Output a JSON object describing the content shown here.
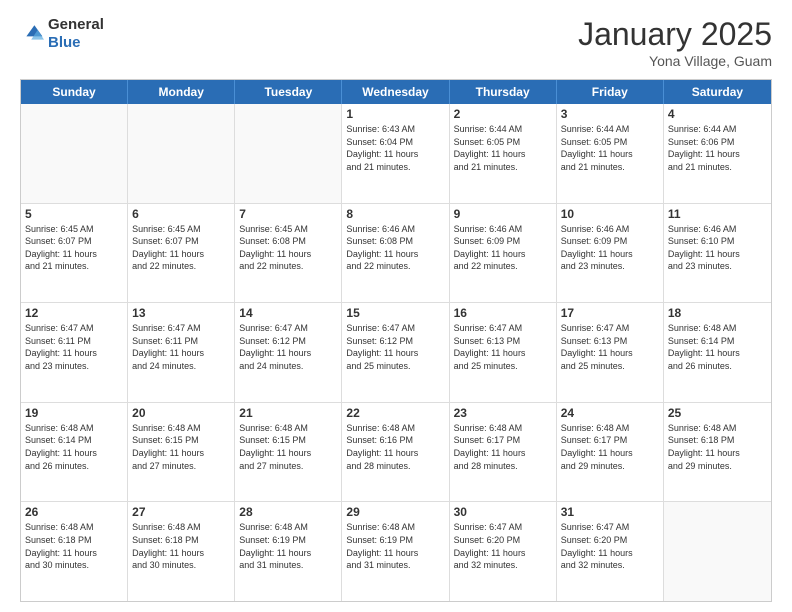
{
  "header": {
    "logo_general": "General",
    "logo_blue": "Blue",
    "month_title": "January 2025",
    "subtitle": "Yona Village, Guam"
  },
  "weekdays": [
    "Sunday",
    "Monday",
    "Tuesday",
    "Wednesday",
    "Thursday",
    "Friday",
    "Saturday"
  ],
  "rows": [
    [
      {
        "day": "",
        "lines": [],
        "empty": true
      },
      {
        "day": "",
        "lines": [],
        "empty": true
      },
      {
        "day": "",
        "lines": [],
        "empty": true
      },
      {
        "day": "1",
        "lines": [
          "Sunrise: 6:43 AM",
          "Sunset: 6:04 PM",
          "Daylight: 11 hours",
          "and 21 minutes."
        ],
        "empty": false
      },
      {
        "day": "2",
        "lines": [
          "Sunrise: 6:44 AM",
          "Sunset: 6:05 PM",
          "Daylight: 11 hours",
          "and 21 minutes."
        ],
        "empty": false
      },
      {
        "day": "3",
        "lines": [
          "Sunrise: 6:44 AM",
          "Sunset: 6:05 PM",
          "Daylight: 11 hours",
          "and 21 minutes."
        ],
        "empty": false
      },
      {
        "day": "4",
        "lines": [
          "Sunrise: 6:44 AM",
          "Sunset: 6:06 PM",
          "Daylight: 11 hours",
          "and 21 minutes."
        ],
        "empty": false
      }
    ],
    [
      {
        "day": "5",
        "lines": [
          "Sunrise: 6:45 AM",
          "Sunset: 6:07 PM",
          "Daylight: 11 hours",
          "and 21 minutes."
        ],
        "empty": false
      },
      {
        "day": "6",
        "lines": [
          "Sunrise: 6:45 AM",
          "Sunset: 6:07 PM",
          "Daylight: 11 hours",
          "and 22 minutes."
        ],
        "empty": false
      },
      {
        "day": "7",
        "lines": [
          "Sunrise: 6:45 AM",
          "Sunset: 6:08 PM",
          "Daylight: 11 hours",
          "and 22 minutes."
        ],
        "empty": false
      },
      {
        "day": "8",
        "lines": [
          "Sunrise: 6:46 AM",
          "Sunset: 6:08 PM",
          "Daylight: 11 hours",
          "and 22 minutes."
        ],
        "empty": false
      },
      {
        "day": "9",
        "lines": [
          "Sunrise: 6:46 AM",
          "Sunset: 6:09 PM",
          "Daylight: 11 hours",
          "and 22 minutes."
        ],
        "empty": false
      },
      {
        "day": "10",
        "lines": [
          "Sunrise: 6:46 AM",
          "Sunset: 6:09 PM",
          "Daylight: 11 hours",
          "and 23 minutes."
        ],
        "empty": false
      },
      {
        "day": "11",
        "lines": [
          "Sunrise: 6:46 AM",
          "Sunset: 6:10 PM",
          "Daylight: 11 hours",
          "and 23 minutes."
        ],
        "empty": false
      }
    ],
    [
      {
        "day": "12",
        "lines": [
          "Sunrise: 6:47 AM",
          "Sunset: 6:11 PM",
          "Daylight: 11 hours",
          "and 23 minutes."
        ],
        "empty": false
      },
      {
        "day": "13",
        "lines": [
          "Sunrise: 6:47 AM",
          "Sunset: 6:11 PM",
          "Daylight: 11 hours",
          "and 24 minutes."
        ],
        "empty": false
      },
      {
        "day": "14",
        "lines": [
          "Sunrise: 6:47 AM",
          "Sunset: 6:12 PM",
          "Daylight: 11 hours",
          "and 24 minutes."
        ],
        "empty": false
      },
      {
        "day": "15",
        "lines": [
          "Sunrise: 6:47 AM",
          "Sunset: 6:12 PM",
          "Daylight: 11 hours",
          "and 25 minutes."
        ],
        "empty": false
      },
      {
        "day": "16",
        "lines": [
          "Sunrise: 6:47 AM",
          "Sunset: 6:13 PM",
          "Daylight: 11 hours",
          "and 25 minutes."
        ],
        "empty": false
      },
      {
        "day": "17",
        "lines": [
          "Sunrise: 6:47 AM",
          "Sunset: 6:13 PM",
          "Daylight: 11 hours",
          "and 25 minutes."
        ],
        "empty": false
      },
      {
        "day": "18",
        "lines": [
          "Sunrise: 6:48 AM",
          "Sunset: 6:14 PM",
          "Daylight: 11 hours",
          "and 26 minutes."
        ],
        "empty": false
      }
    ],
    [
      {
        "day": "19",
        "lines": [
          "Sunrise: 6:48 AM",
          "Sunset: 6:14 PM",
          "Daylight: 11 hours",
          "and 26 minutes."
        ],
        "empty": false
      },
      {
        "day": "20",
        "lines": [
          "Sunrise: 6:48 AM",
          "Sunset: 6:15 PM",
          "Daylight: 11 hours",
          "and 27 minutes."
        ],
        "empty": false
      },
      {
        "day": "21",
        "lines": [
          "Sunrise: 6:48 AM",
          "Sunset: 6:15 PM",
          "Daylight: 11 hours",
          "and 27 minutes."
        ],
        "empty": false
      },
      {
        "day": "22",
        "lines": [
          "Sunrise: 6:48 AM",
          "Sunset: 6:16 PM",
          "Daylight: 11 hours",
          "and 28 minutes."
        ],
        "empty": false
      },
      {
        "day": "23",
        "lines": [
          "Sunrise: 6:48 AM",
          "Sunset: 6:17 PM",
          "Daylight: 11 hours",
          "and 28 minutes."
        ],
        "empty": false
      },
      {
        "day": "24",
        "lines": [
          "Sunrise: 6:48 AM",
          "Sunset: 6:17 PM",
          "Daylight: 11 hours",
          "and 29 minutes."
        ],
        "empty": false
      },
      {
        "day": "25",
        "lines": [
          "Sunrise: 6:48 AM",
          "Sunset: 6:18 PM",
          "Daylight: 11 hours",
          "and 29 minutes."
        ],
        "empty": false
      }
    ],
    [
      {
        "day": "26",
        "lines": [
          "Sunrise: 6:48 AM",
          "Sunset: 6:18 PM",
          "Daylight: 11 hours",
          "and 30 minutes."
        ],
        "empty": false
      },
      {
        "day": "27",
        "lines": [
          "Sunrise: 6:48 AM",
          "Sunset: 6:18 PM",
          "Daylight: 11 hours",
          "and 30 minutes."
        ],
        "empty": false
      },
      {
        "day": "28",
        "lines": [
          "Sunrise: 6:48 AM",
          "Sunset: 6:19 PM",
          "Daylight: 11 hours",
          "and 31 minutes."
        ],
        "empty": false
      },
      {
        "day": "29",
        "lines": [
          "Sunrise: 6:48 AM",
          "Sunset: 6:19 PM",
          "Daylight: 11 hours",
          "and 31 minutes."
        ],
        "empty": false
      },
      {
        "day": "30",
        "lines": [
          "Sunrise: 6:47 AM",
          "Sunset: 6:20 PM",
          "Daylight: 11 hours",
          "and 32 minutes."
        ],
        "empty": false
      },
      {
        "day": "31",
        "lines": [
          "Sunrise: 6:47 AM",
          "Sunset: 6:20 PM",
          "Daylight: 11 hours",
          "and 32 minutes."
        ],
        "empty": false
      },
      {
        "day": "",
        "lines": [],
        "empty": true
      }
    ]
  ]
}
